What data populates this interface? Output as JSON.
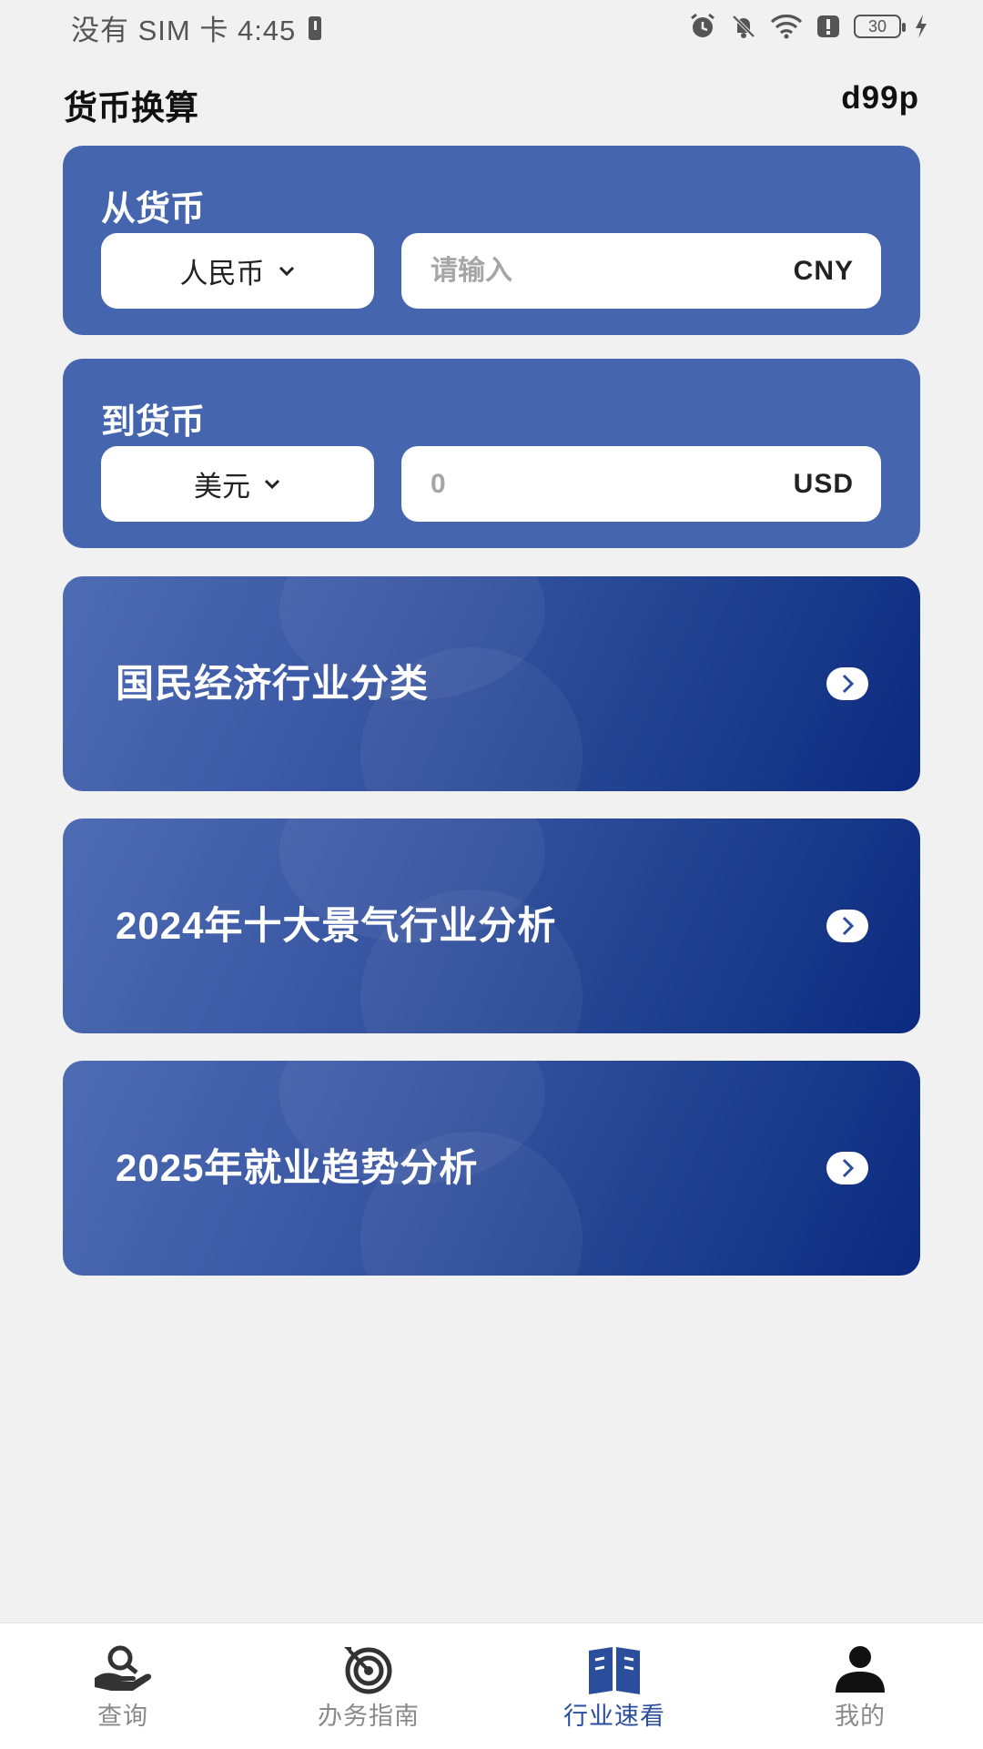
{
  "status_bar": {
    "left_text": "没有 SIM 卡 4:45",
    "battery_level": "30"
  },
  "header": {
    "title": "货币换算",
    "right_text": "d99p"
  },
  "converter": {
    "from": {
      "label": "从货币",
      "currency": "人民币",
      "placeholder": "请输入",
      "code": "CNY"
    },
    "to": {
      "label": "到货币",
      "currency": "美元",
      "value": "0",
      "code": "USD"
    }
  },
  "features": [
    {
      "title": "国民经济行业分类"
    },
    {
      "title": "2024年十大景气行业分析"
    },
    {
      "title": "2025年就业趋势分析"
    }
  ],
  "bottom_nav": {
    "items": [
      {
        "label": "查询",
        "icon": "search-hand-icon"
      },
      {
        "label": "办务指南",
        "icon": "target-icon"
      },
      {
        "label": "行业速看",
        "icon": "book-icon"
      },
      {
        "label": "我的",
        "icon": "person-icon"
      }
    ],
    "active_index": 2
  },
  "colors": {
    "background": "#f1f1f1",
    "card": "#4566ae",
    "banner_start": "#4e6cb3",
    "banner_end": "#0b2a80",
    "active_nav": "#2a4d9c",
    "inactive_nav": "#8a8a8a"
  }
}
